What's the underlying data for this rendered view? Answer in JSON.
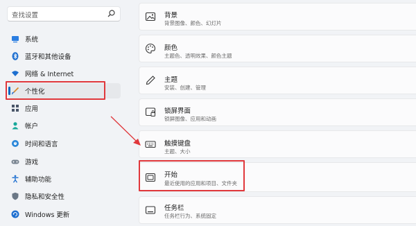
{
  "search": {
    "placeholder": "查找设置"
  },
  "sidebar": {
    "items": [
      {
        "label": "系统",
        "icon": "system-icon"
      },
      {
        "label": "蓝牙和其他设备",
        "icon": "bluetooth-icon"
      },
      {
        "label": "网络 & Internet",
        "icon": "wifi-icon"
      },
      {
        "label": "个性化",
        "icon": "brush-icon",
        "selected": true
      },
      {
        "label": "应用",
        "icon": "apps-icon"
      },
      {
        "label": "帐户",
        "icon": "account-icon"
      },
      {
        "label": "时间和语言",
        "icon": "globe-clock-icon"
      },
      {
        "label": "游戏",
        "icon": "gamepad-icon"
      },
      {
        "label": "辅助功能",
        "icon": "accessibility-icon"
      },
      {
        "label": "隐私和安全性",
        "icon": "shield-icon"
      },
      {
        "label": "Windows 更新",
        "icon": "update-icon"
      }
    ]
  },
  "cards": [
    {
      "title": "背景",
      "subtitle": "背景图像、颜色、幻灯片",
      "icon": "picture-icon"
    },
    {
      "title": "颜色",
      "subtitle": "主题色、透明效果、颜色主题",
      "icon": "palette-icon"
    },
    {
      "title": "主题",
      "subtitle": "安装、创建、管理",
      "icon": "pen-icon"
    },
    {
      "title": "锁屏界面",
      "subtitle": "锁屏图像、应用和动画",
      "icon": "lock-screen-icon"
    },
    {
      "title": "触摸键盘",
      "subtitle": "主题、大小",
      "icon": "keyboard-icon"
    },
    {
      "title": "开始",
      "subtitle": "最近使用的应用和项目、文件夹",
      "icon": "start-icon"
    },
    {
      "title": "任务栏",
      "subtitle": "任务栏行为、系统固定",
      "icon": "taskbar-icon"
    }
  ],
  "colors": {
    "accent": "#0067c0",
    "annotation_red": "#e0373b"
  }
}
